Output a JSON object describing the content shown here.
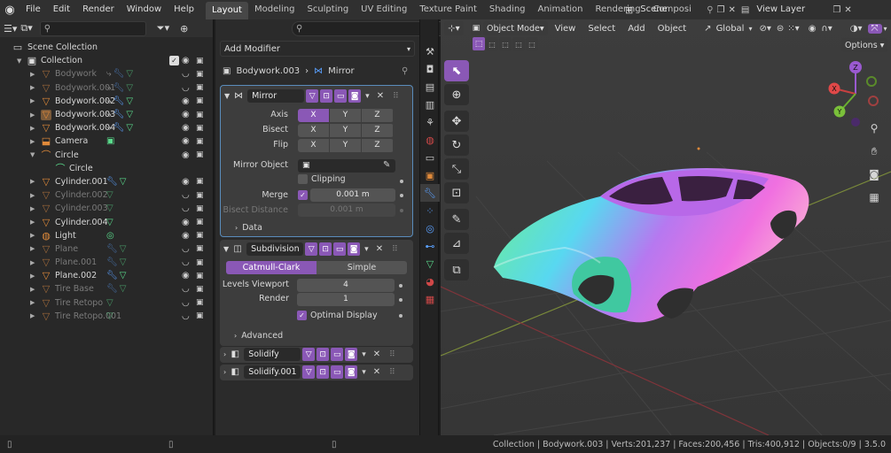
{
  "topbar": {
    "menus": [
      "File",
      "Edit",
      "Render",
      "Window",
      "Help"
    ],
    "workspaces": [
      "Layout",
      "Modeling",
      "Sculpting",
      "UV Editing",
      "Texture Paint",
      "Shading",
      "Animation",
      "Rendering",
      "Compositi"
    ],
    "active_workspace": "Layout",
    "scene": "Scene",
    "view_layer": "View Layer"
  },
  "outliner": {
    "root": "Scene Collection",
    "collection": "Collection",
    "items": [
      {
        "name": "Bodywork",
        "icon": "mesh-triangle-icon",
        "dim": true
      },
      {
        "name": "Bodywork.001",
        "icon": "mesh-triangle-icon",
        "dim": true
      },
      {
        "name": "Bodywork.002",
        "icon": "mesh-triangle-icon",
        "dim": false
      },
      {
        "name": "Bodywork.003",
        "icon": "mesh-triangle-icon",
        "dim": false
      },
      {
        "name": "Bodywork.004",
        "icon": "mesh-triangle-icon",
        "dim": false
      },
      {
        "name": "Camera",
        "icon": "camera-object-icon",
        "dim": false
      },
      {
        "name": "Circle",
        "icon": "curve-icon",
        "dim": false
      },
      {
        "name": "Circle",
        "icon": "curve-data-icon",
        "dim": false
      },
      {
        "name": "Cylinder.001",
        "icon": "mesh-triangle-icon",
        "dim": false
      },
      {
        "name": "Cylinder.002",
        "icon": "mesh-triangle-icon",
        "dim": true
      },
      {
        "name": "Cylinder.003",
        "icon": "mesh-triangle-icon",
        "dim": true
      },
      {
        "name": "Cylinder.004",
        "icon": "mesh-triangle-icon",
        "dim": false
      },
      {
        "name": "Light",
        "icon": "light-bulb-icon",
        "dim": false
      },
      {
        "name": "Plane",
        "icon": "mesh-triangle-icon",
        "dim": true
      },
      {
        "name": "Plane.001",
        "icon": "mesh-triangle-icon",
        "dim": true
      },
      {
        "name": "Plane.002",
        "icon": "mesh-triangle-icon",
        "dim": false
      },
      {
        "name": "Tire Base",
        "icon": "mesh-triangle-icon",
        "dim": true
      },
      {
        "name": "Tire Retopo",
        "icon": "mesh-triangle-icon",
        "dim": true
      },
      {
        "name": "Tire Retopo.001",
        "icon": "mesh-triangle-icon",
        "dim": true
      }
    ]
  },
  "properties": {
    "add_modifier": "Add Modifier",
    "breadcrumb_object": "Bodywork.003",
    "breadcrumb_modifier": "Mirror",
    "mirror": {
      "name": "Mirror",
      "axis_label": "Axis",
      "bisect_label": "Bisect",
      "flip_label": "Flip",
      "axes": [
        "X",
        "Y",
        "Z"
      ],
      "mirror_object_label": "Mirror Object",
      "clipping_label": "Clipping",
      "merge_label": "Merge",
      "merge_value": "0.001 m",
      "bisect_distance_label": "Bisect Distance",
      "bisect_distance_value": "0.001 m",
      "data_label": "Data"
    },
    "subdivision": {
      "name": "Subdivision",
      "catmull": "Catmull-Clark",
      "simple": "Simple",
      "levels_label": "Levels Viewport",
      "levels_value": "4",
      "render_label": "Render",
      "render_value": "1",
      "optimal_label": "Optimal Display",
      "advanced_label": "Advanced"
    },
    "solidify": {
      "name": "Solidify"
    },
    "solidify2": {
      "name": "Solidify.001"
    }
  },
  "viewport": {
    "mode": "Object Mode",
    "menus": [
      "View",
      "Select",
      "Add",
      "Object"
    ],
    "orientation": "Global",
    "options": "Options",
    "gizmo": {
      "x": "X",
      "y": "Y",
      "z": "Z"
    }
  },
  "status": {
    "text": "Collection | Bodywork.003 | Verts:201,237 | Faces:200,456 | Tris:400,912 | Objects:0/9 | 3.5.0"
  },
  "colors": {
    "accent": "#8a58b6",
    "mesh_icon": "#e08a3a",
    "modifier_icon": "#5aa0ff",
    "data_icon": "#5adc8c"
  }
}
